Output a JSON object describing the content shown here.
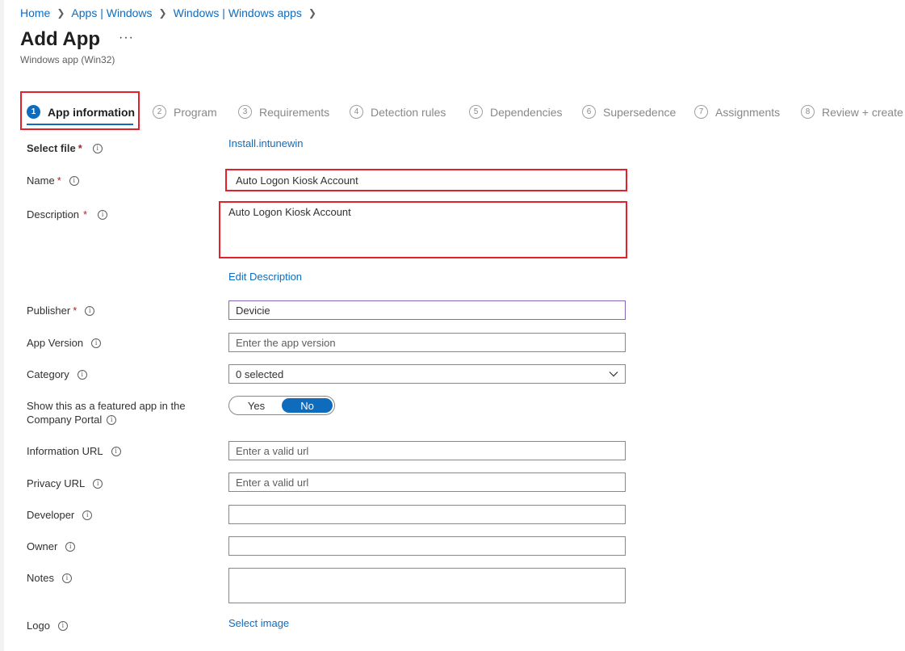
{
  "breadcrumb": [
    "Home",
    "Apps | Windows",
    "Windows | Windows apps"
  ],
  "page": {
    "title": "Add App",
    "more": "···",
    "subtitle": "Windows app (Win32)"
  },
  "steps": [
    {
      "num": "1",
      "label": "App information",
      "active": true
    },
    {
      "num": "2",
      "label": "Program"
    },
    {
      "num": "3",
      "label": "Requirements"
    },
    {
      "num": "4",
      "label": "Detection rules"
    },
    {
      "num": "5",
      "label": "Dependencies"
    },
    {
      "num": "6",
      "label": "Supersedence"
    },
    {
      "num": "7",
      "label": "Assignments"
    },
    {
      "num": "8",
      "label": "Review + create"
    }
  ],
  "form": {
    "select_file": {
      "label": "Select file",
      "value": "Install.intunewin"
    },
    "name": {
      "label": "Name",
      "value": "Auto Logon Kiosk Account"
    },
    "description": {
      "label": "Description",
      "value": "Auto Logon Kiosk Account",
      "edit_link": "Edit Description"
    },
    "publisher": {
      "label": "Publisher",
      "value": "Devicie"
    },
    "app_version": {
      "label": "App Version",
      "placeholder": "Enter the app version"
    },
    "category": {
      "label": "Category",
      "value": "0 selected"
    },
    "featured": {
      "label_line1": "Show this as a featured app in the",
      "label_line2": "Company Portal",
      "yes": "Yes",
      "no": "No",
      "selected": "No"
    },
    "info_url": {
      "label": "Information URL",
      "placeholder": "Enter a valid url"
    },
    "privacy_url": {
      "label": "Privacy URL",
      "placeholder": "Enter a valid url"
    },
    "developer": {
      "label": "Developer",
      "value": ""
    },
    "owner": {
      "label": "Owner",
      "value": ""
    },
    "notes": {
      "label": "Notes",
      "value": ""
    },
    "logo": {
      "label": "Logo",
      "link": "Select image"
    }
  },
  "required_marker": "*",
  "info_glyph": "i",
  "colors": {
    "accent": "#0f6cbd",
    "highlight": "#e3202b",
    "required": "#a4262c"
  }
}
